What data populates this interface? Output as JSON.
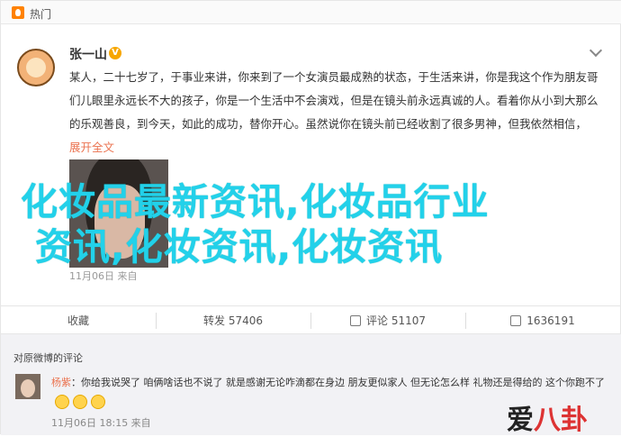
{
  "topbar": {
    "label": "热门"
  },
  "post": {
    "username": "张一山",
    "verified_badge": "V",
    "body": "某人，二十七岁了，于事业来讲，你来到了一个女演员最成熟的状态，于生活来讲，你是我这个作为朋友哥们儿眼里永远长不大的孩子，你是一个生活中不会演戏，但是在镜头前永远真诚的人。看着你从小到大那么的乐观善良，到今天，如此的成功，替你开心。虽然说你在镜头前已经收割了很多男神，但我依然相信，",
    "expand_label": "展开全文",
    "overlay_line1": "化妆品最新资讯,化妆品行业",
    "overlay_line2": "资讯,化妆资讯,化妆资讯",
    "date": "11月06日  来自"
  },
  "actions": [
    {
      "label": "收藏",
      "icon": "star-icon"
    },
    {
      "label": "转发 57406",
      "icon": "repost-icon"
    },
    {
      "label": "评论 51107",
      "icon": "comment-icon"
    },
    {
      "label": "1636191",
      "icon": "like-icon"
    }
  ],
  "comments": {
    "title": "对原微博的评论",
    "items": [
      {
        "name": "杨紫",
        "text": "：你给我说哭了 咱俩啥话也不说了 就是感谢无论咋滴都在身边 朋友更似家人 但无论怎么样 礼物还是得给的 这个你跑不了",
        "meta": "11月06日 18:15 来自"
      }
    ]
  },
  "watermark": {
    "line1": "爱",
    "line2": "八卦"
  }
}
